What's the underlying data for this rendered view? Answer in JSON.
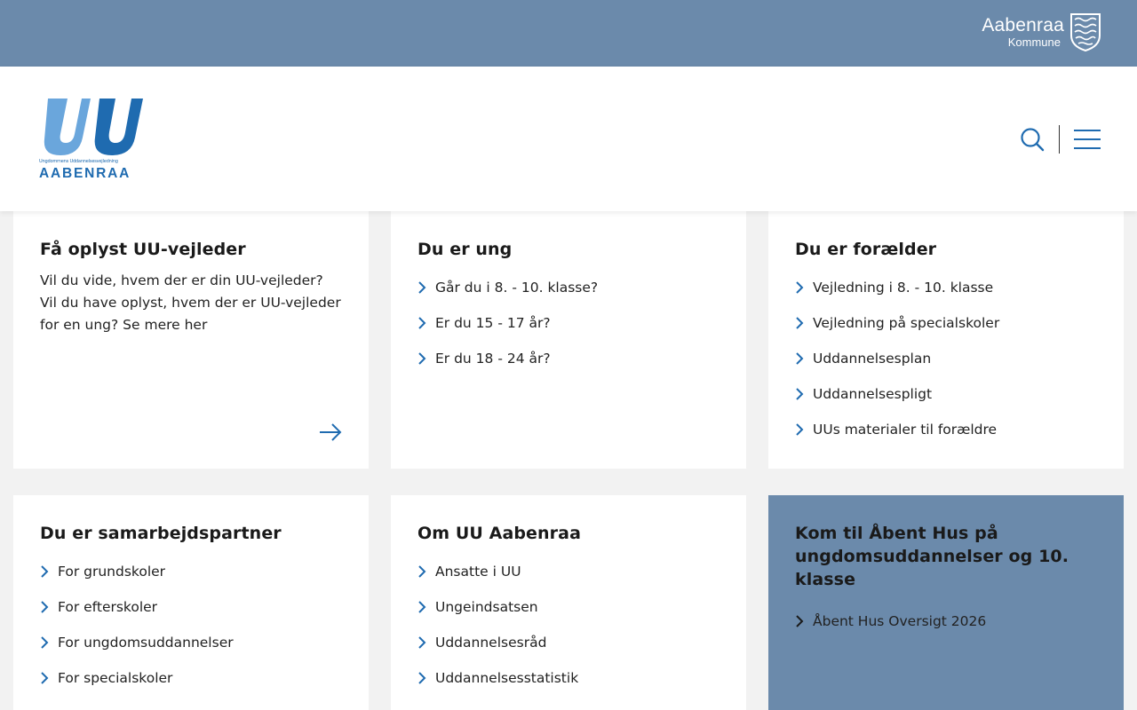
{
  "topbar": {
    "kommune_name": "Aabenraa",
    "kommune_sub": "Kommune"
  },
  "header": {
    "logo_text": "UU",
    "logo_subtitle": "Ungdommens Uddannelsesvejledning",
    "logo_city": "AABENRAA",
    "icons": [
      "search-icon",
      "menu-icon"
    ]
  },
  "cards": {
    "find_vejleder": {
      "title": "Få oplyst UU-vejleder",
      "text": "Vil du vide, hvem der er din UU-vejleder? Vil du have oplyst, hvem der er UU-vejleder for en ung? Se mere her"
    },
    "ung": {
      "title": "Du er ung",
      "items": [
        "Går du i 8. - 10. klasse?",
        "Er du 15 - 17 år?",
        "Er du 18 - 24 år?"
      ]
    },
    "foraelder": {
      "title": "Du er forælder",
      "items": [
        "Vejledning i 8. - 10. klasse",
        "Vejledning på specialskoler",
        "Uddannelsesplan",
        "Uddannelsespligt",
        "UUs materialer til forældre"
      ]
    },
    "samarbejd": {
      "title": "Du er samarbejdspartner",
      "items": [
        "For grundskoler",
        "For efterskoler",
        "For ungdomsuddannelser",
        "For specialskoler"
      ]
    },
    "om": {
      "title": "Om UU Aabenraa",
      "items": [
        "Ansatte i UU",
        "Ungeindsatsen",
        "Uddannelsesråd",
        "Uddannelsesstatistik"
      ]
    },
    "aabent_hus": {
      "title": "Kom til Åbent Hus på ungdomsuddannelser og 10. klasse",
      "items": [
        "Åbent Hus Oversigt 2026"
      ]
    }
  },
  "colors": {
    "topbar": "#6b8aab",
    "brand_blue": "#1f6bb0",
    "light_blue": "#6aa6dc",
    "background": "#f2f2f2"
  }
}
